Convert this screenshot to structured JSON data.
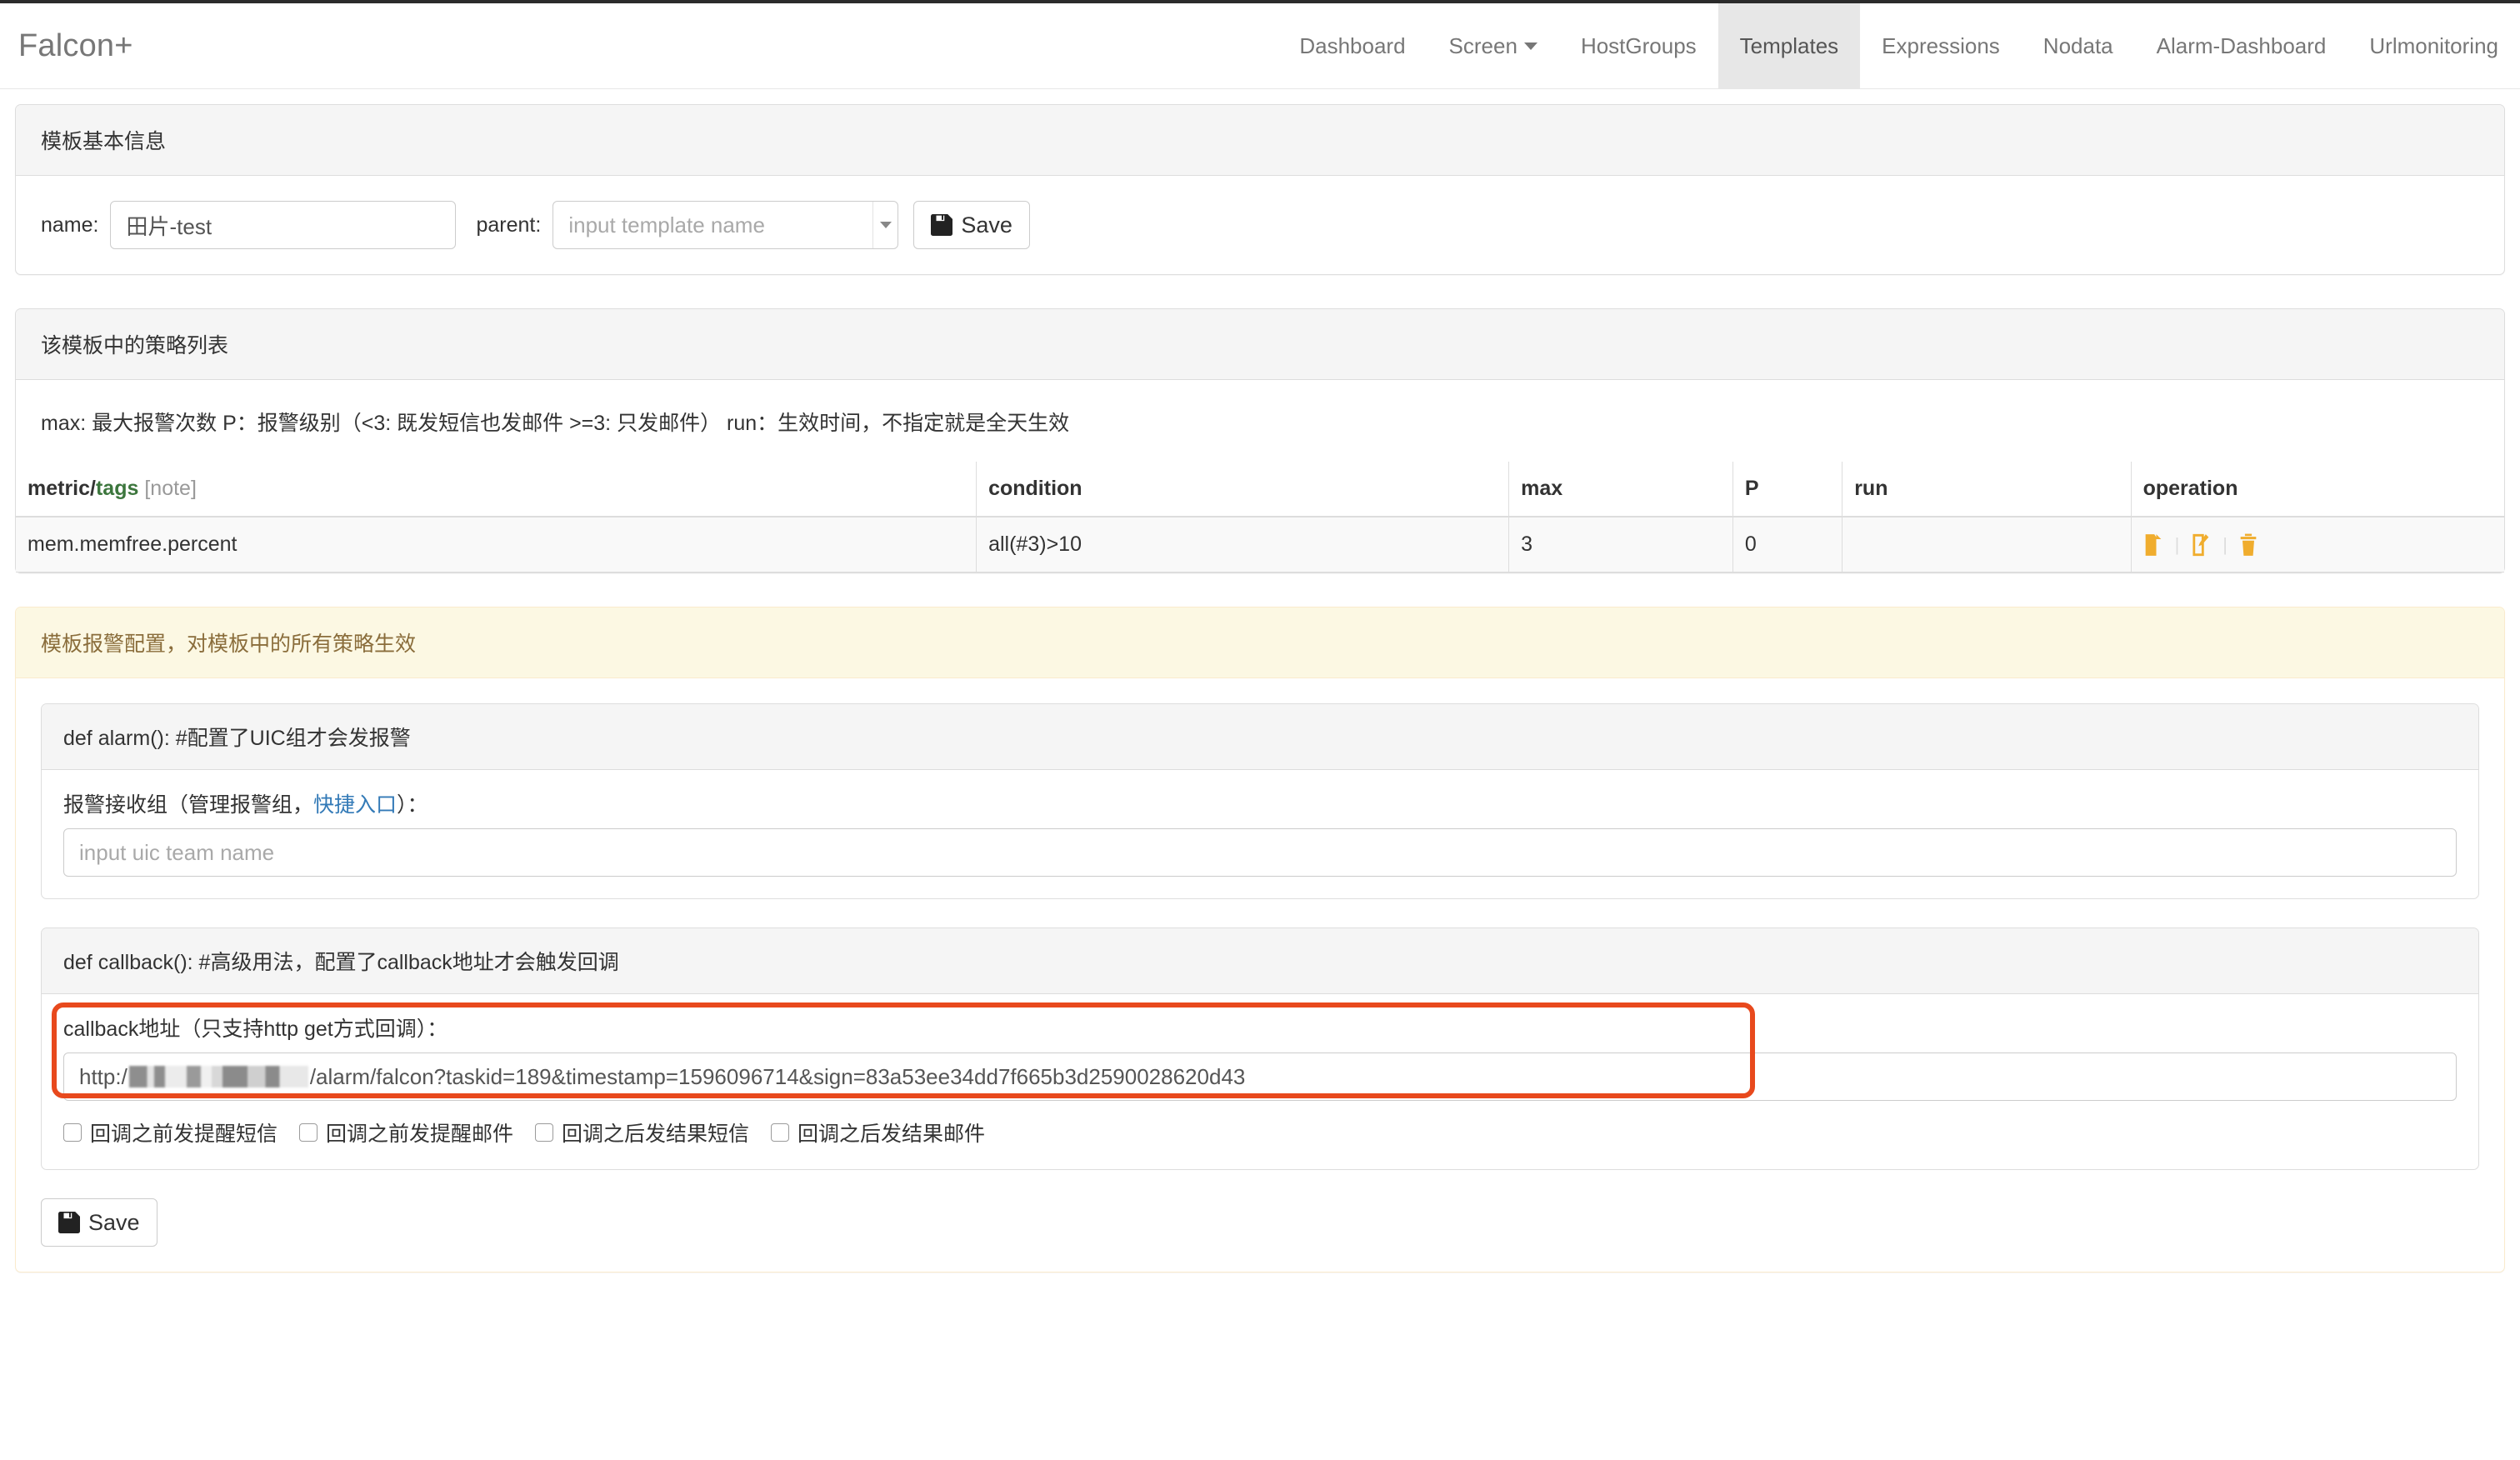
{
  "brand": "Falcon+",
  "nav": {
    "items": [
      {
        "label": "Dashboard",
        "active": false,
        "caret": false
      },
      {
        "label": "Screen",
        "active": false,
        "caret": true
      },
      {
        "label": "HostGroups",
        "active": false,
        "caret": false
      },
      {
        "label": "Templates",
        "active": true,
        "caret": false
      },
      {
        "label": "Expressions",
        "active": false,
        "caret": false
      },
      {
        "label": "Nodata",
        "active": false,
        "caret": false
      },
      {
        "label": "Alarm-Dashboard",
        "active": false,
        "caret": false
      },
      {
        "label": "Urlmonitoring",
        "active": false,
        "caret": false
      }
    ]
  },
  "basic_info": {
    "title": "模板基本信息",
    "name_label": "name:",
    "name_value": "田片-test",
    "parent_label": "parent:",
    "parent_placeholder": "input template name",
    "parent_value": "",
    "save_label": "Save"
  },
  "strategy": {
    "title": "该模板中的策略列表",
    "help": "max: 最大报警次数 P：报警级别（<3: 既发短信也发邮件 >=3: 只发邮件） run：生效时间，不指定就是全天生效",
    "columns": {
      "metric": "metric/",
      "metric_tags": "tags",
      "metric_note": "[note]",
      "condition": "condition",
      "max": "max",
      "p": "P",
      "run": "run",
      "operation": "operation"
    },
    "rows": [
      {
        "metric": "mem.memfree.percent",
        "condition": "all(#3)>10",
        "max": "3",
        "p": "0",
        "run": "",
        "operations": [
          "clone-icon",
          "edit-icon",
          "trash-icon"
        ]
      }
    ]
  },
  "alarm_config": {
    "title": "模板报警配置，对模板中的所有策略生效",
    "alarm_block": {
      "heading": "def alarm(): #配置了UIC组才会发报警",
      "label_prefix": "报警接收组（管理报警组，",
      "label_link": "快捷入口",
      "label_suffix": "）：",
      "input_placeholder": "input uic team name",
      "input_value": ""
    },
    "callback_block": {
      "heading": "def callback(): #高级用法，配置了callback地址才会触发回调",
      "label": "callback地址（只支持http get方式回调）：",
      "url_prefix": "http:/",
      "url_redacted": "████ ▉ ▆████ ▃▆████████ ▉",
      "url_suffix": "/alarm/falcon?taskid=189&timestamp=1596096714&sign=83a53ee34dd7f665b3d2590028620d43",
      "checkboxes": [
        {
          "label": "回调之前发提醒短信",
          "checked": false
        },
        {
          "label": "回调之前发提醒邮件",
          "checked": false
        },
        {
          "label": "回调之后发结果短信",
          "checked": false
        },
        {
          "label": "回调之后发结果邮件",
          "checked": false
        }
      ]
    },
    "save_label": "Save"
  },
  "colors": {
    "accent_orange": "#e8491d",
    "link_blue": "#337ab7",
    "tag_green": "#3c763d",
    "icon_orange": "#f0ad2e",
    "warning_bg": "#fcf8e3",
    "warning_text": "#8a6d3b"
  }
}
